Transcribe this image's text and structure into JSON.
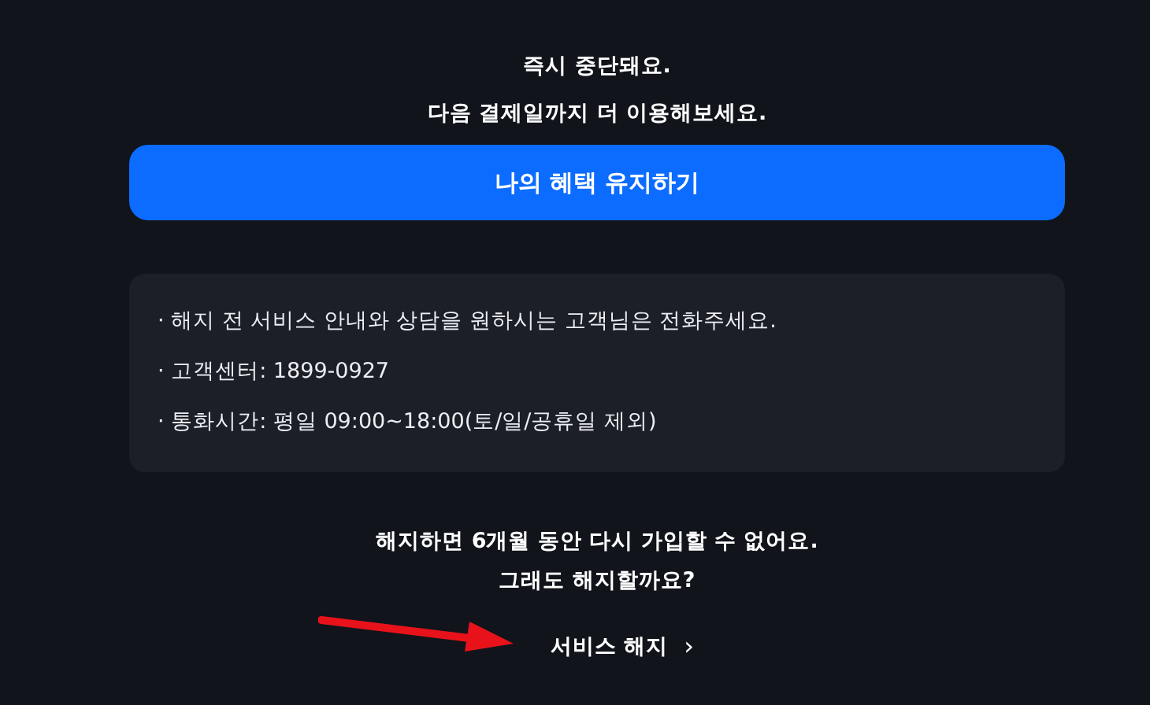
{
  "notice_lines": [
    "즉시 중단돼요.",
    "다음 결제일까지 더 이용해보세요."
  ],
  "keep_button": {
    "label": "나의 혜택 유지하기"
  },
  "info": [
    "· 해지 전 서비스 안내와 상담을 원하시는 고객님은 전화주세요.",
    "· 고객센터: 1899-0927",
    "· 통화시간: 평일 09:00~18:00(토/일/공휴일 제외)"
  ],
  "warning_lines": [
    "해지하면 6개월 동안 다시 가입할 수 없어요.",
    "그래도 해지할까요?"
  ],
  "cancel_link": {
    "label": "서비스 해지",
    "chevron": "›"
  }
}
